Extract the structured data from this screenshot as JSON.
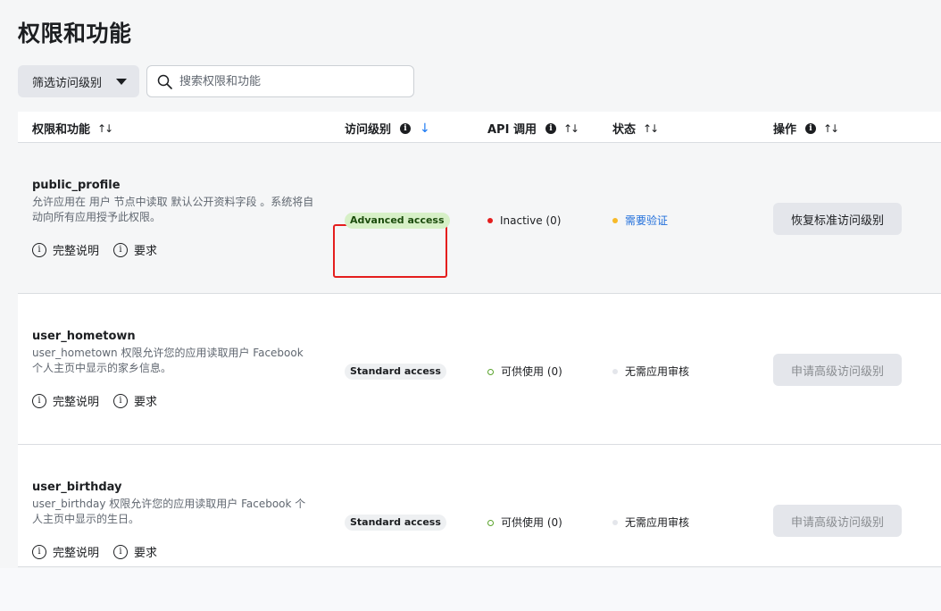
{
  "page": {
    "title": "权限和功能"
  },
  "filter": {
    "label": "筛选访问级别"
  },
  "search": {
    "placeholder": "搜索权限和功能"
  },
  "columns": {
    "perm": "权限和功能",
    "access": "访问级别",
    "api": "API 调用",
    "status": "状态",
    "action": "操作"
  },
  "rows": [
    {
      "name": "public_profile",
      "desc": "允许应用在 用户 节点中读取 默认公开资料字段 。系统将自动向所有应用授予此权限。",
      "link_full": "完整说明",
      "link_req": "要求",
      "access": "Advanced access",
      "api": "Inactive (0)",
      "status": "需要验证",
      "action": "恢复标准访问级别"
    },
    {
      "name": "user_hometown",
      "desc": "user_hometown 权限允许您的应用读取用户 Facebook 个人主页中显示的家乡信息。",
      "link_full": "完整说明",
      "link_req": "要求",
      "access": "Standard access",
      "api": "可供使用 (0)",
      "status": "无需应用审核",
      "action": "申请高级访问级别"
    },
    {
      "name": "user_birthday",
      "desc": "user_birthday 权限允许您的应用读取用户 Facebook 个人主页中显示的生日。",
      "link_full": "完整说明",
      "link_req": "要求",
      "access": "Standard access",
      "api": "可供使用 (0)",
      "status": "无需应用审核",
      "action": "申请高级访问级别"
    }
  ],
  "colors": {
    "highlight": "#e41e1e",
    "advanced_badge": "#d7f0c7",
    "link_blue": "#216fdb"
  }
}
